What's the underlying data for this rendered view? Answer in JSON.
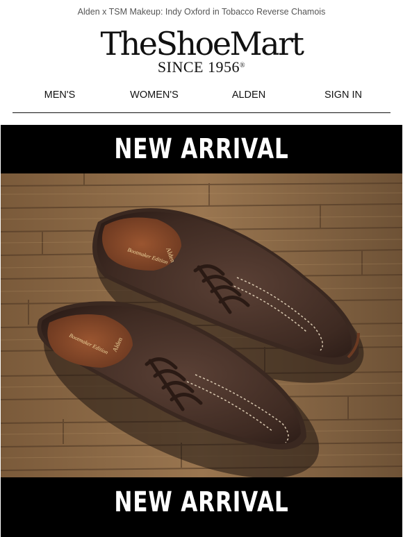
{
  "preheader": "Alden x TSM Makeup: Indy Oxford in Tobacco Reverse Chamois",
  "logo": {
    "name": "TheShoeMart",
    "tagline": "SINCE 1956",
    "mark": "®"
  },
  "nav": [
    {
      "label": "MEN'S"
    },
    {
      "label": "WOMEN'S"
    },
    {
      "label": "ALDEN"
    },
    {
      "label": "SIGN IN"
    }
  ],
  "banner_top": "NEW ARRIVAL",
  "banner_bottom": "NEW ARRIVAL",
  "product_image": {
    "insole_text": "Bootmaker Edition",
    "insole_brand": "Alden"
  }
}
